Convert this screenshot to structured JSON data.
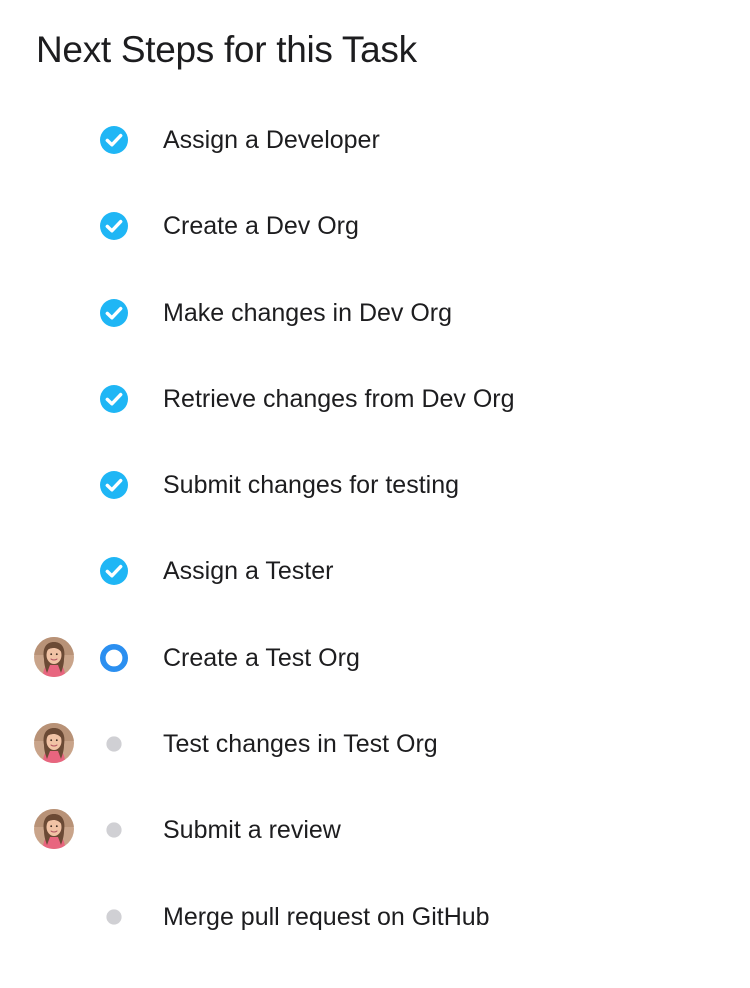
{
  "title": "Next Steps for this Task",
  "colors": {
    "accent": "#1fb6f5",
    "current": "#2b8ff0",
    "pending": "#d0d0d4"
  },
  "steps": [
    {
      "label": "Assign a Developer",
      "status": "completed",
      "has_avatar": false
    },
    {
      "label": "Create a Dev Org",
      "status": "completed",
      "has_avatar": false
    },
    {
      "label": "Make changes in Dev Org",
      "status": "completed",
      "has_avatar": false
    },
    {
      "label": "Retrieve changes from Dev Org",
      "status": "completed",
      "has_avatar": false
    },
    {
      "label": "Submit changes for testing",
      "status": "completed",
      "has_avatar": false
    },
    {
      "label": "Assign a Tester",
      "status": "completed",
      "has_avatar": false
    },
    {
      "label": "Create a Test Org",
      "status": "current",
      "has_avatar": true
    },
    {
      "label": "Test changes in Test Org",
      "status": "pending",
      "has_avatar": true
    },
    {
      "label": "Submit a review",
      "status": "pending",
      "has_avatar": true
    },
    {
      "label": "Merge pull request on GitHub",
      "status": "pending",
      "has_avatar": false
    }
  ],
  "icons": {
    "completed": "check-circle-icon",
    "current": "ring-circle-icon",
    "pending": "dot-icon"
  }
}
